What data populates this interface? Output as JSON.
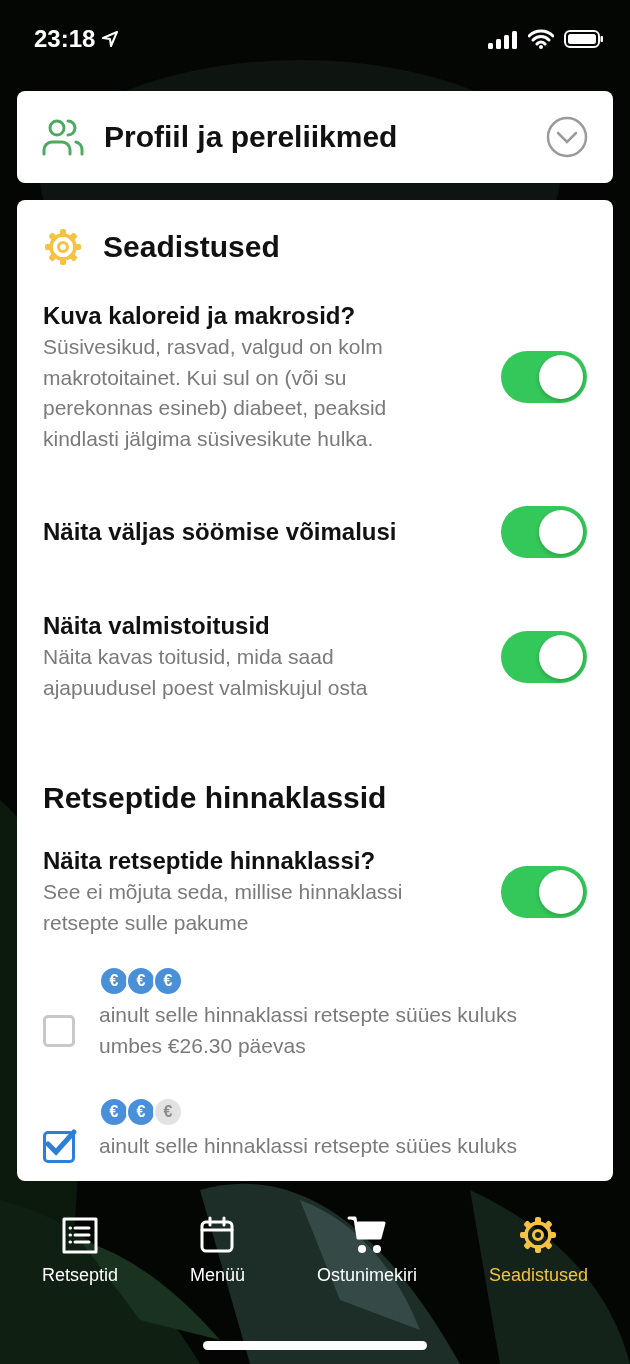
{
  "status_bar": {
    "time": "23:18"
  },
  "profile_card": {
    "title": "Profiil ja pereliikmed",
    "expanded": false
  },
  "settings_card": {
    "title": "Seadistused",
    "settings": [
      {
        "title": "Kuva kaloreid ja makrosid?",
        "description": "Süsivesikud, rasvad, valgud on kolm makrotoitainet. Kui sul on (või su perekonnas esineb) diabeet, peaksid kindlasti jälgima süsivesikute hulka.",
        "on": true
      },
      {
        "title": "Näita väljas söömise võimalusi",
        "on": true
      },
      {
        "title": "Näita valmistoitusid",
        "description": "Näita kavas toitusid, mida saad ajapuudusel poest valmiskujul osta",
        "on": true
      }
    ],
    "section_title": "Retseptide hinnaklassid",
    "price_setting": {
      "title": "Näita retseptide hinnaklassi?",
      "description": "See ei mõjuta seda, millise hinnaklassi retsepte sulle pakume",
      "on": true
    },
    "tiers": [
      {
        "coins": [
          {
            "label": "€",
            "active": true
          },
          {
            "label": "€",
            "active": true
          },
          {
            "label": "€",
            "active": true
          }
        ],
        "text": "ainult selle hinnaklassi retsepte süües kuluks umbes €26.30 päevas",
        "checked": false
      },
      {
        "coins": [
          {
            "label": "€",
            "active": true
          },
          {
            "label": "€",
            "active": true
          },
          {
            "label": "€",
            "active": false
          }
        ],
        "text": "ainult selle hinnaklassi retsepte süües kuluks",
        "checked": true
      }
    ]
  },
  "tab_bar": [
    {
      "kind": "list",
      "label": "Retseptid",
      "selected": false
    },
    {
      "kind": "calendar",
      "label": "Menüü",
      "selected": false
    },
    {
      "kind": "cart",
      "label": "Ostunimekiri",
      "selected": false
    },
    {
      "kind": "gear",
      "label": "Seadistused",
      "selected": true
    }
  ]
}
